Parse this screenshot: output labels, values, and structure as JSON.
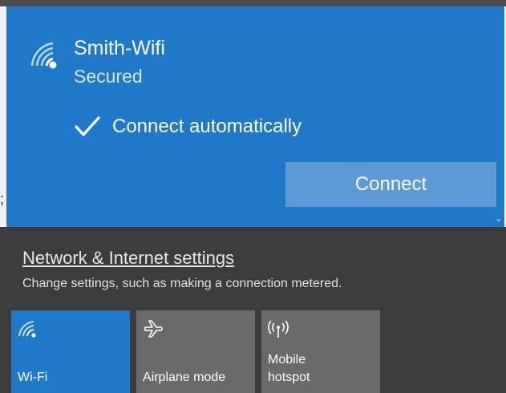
{
  "network": {
    "name": "Smith-Wifi",
    "status": "Secured",
    "auto_connect_label": "Connect automatically",
    "auto_connect_checked": true,
    "connect_label": "Connect",
    "icon": "wifi-icon"
  },
  "settings": {
    "link_label": "Network & Internet settings",
    "description": "Change settings, such as making a connection metered."
  },
  "quick_actions": [
    {
      "label": "Wi-Fi",
      "icon": "wifi-icon",
      "active": true
    },
    {
      "label": "Airplane mode",
      "icon": "airplane-icon",
      "active": false
    },
    {
      "label_line1": "Mobile",
      "label_line2": "hotspot",
      "icon": "hotspot-icon",
      "active": false
    }
  ],
  "colors": {
    "accent": "#1f78c8",
    "connect_button": "#5b9ad4",
    "panel_dark": "#3c3c3c",
    "tile_inactive": "#6a6a6a"
  }
}
